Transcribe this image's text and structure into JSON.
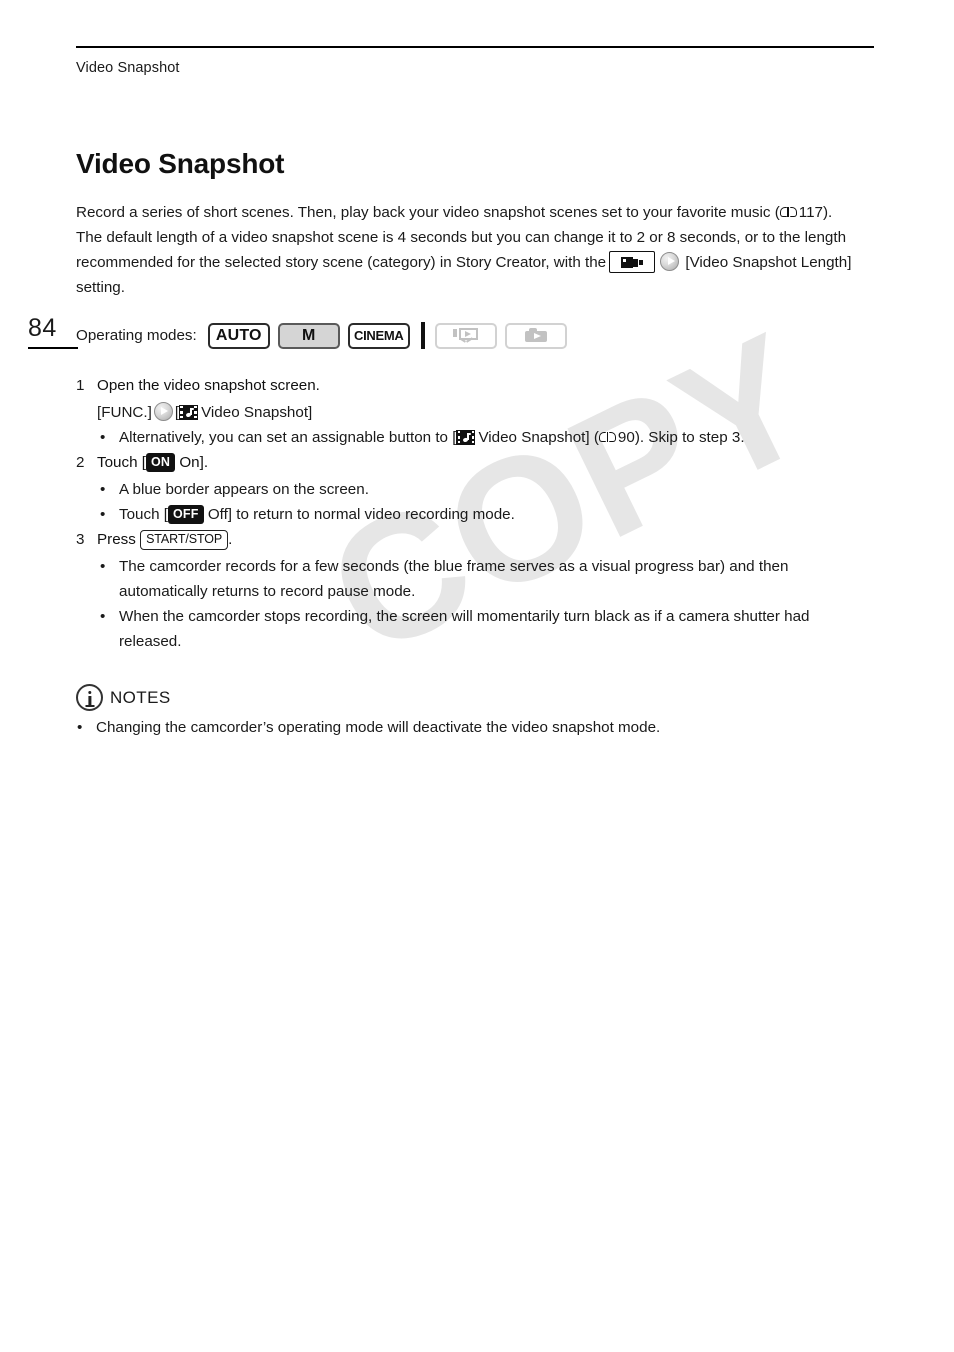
{
  "page": {
    "number": "84",
    "running_head": "Video Snapshot",
    "watermark": "COPY"
  },
  "section": {
    "title": "Video Snapshot",
    "intro_1": "Record a series of short scenes. Then, play back your video snapshot scenes set to your favorite music (",
    "intro_1_ref": "117",
    "intro_1_end": ").",
    "intro_2": "The default length of a video snapshot scene is 4 seconds but you can change it to 2 or 8 seconds, or to the length recommended for the selected story scene (category) in Story Creator, with the",
    "intro_2_end": "[Video Snapshot Length] setting."
  },
  "operating_modes": {
    "label": "Operating modes:",
    "badges": [
      {
        "label": "AUTO",
        "state": "enabled",
        "style": "outline"
      },
      {
        "label": "M",
        "state": "enabled",
        "style": "filled"
      },
      {
        "label": "CINEMA",
        "state": "enabled",
        "style": "outline"
      },
      {
        "label": "",
        "state": "disabled",
        "icon": "movie-playback-icon"
      },
      {
        "label": "",
        "state": "disabled",
        "icon": "photo-playback-icon"
      }
    ]
  },
  "steps": [
    {
      "number": "1",
      "title": "Open the video snapshot screen.",
      "menu_path_start": "[FUNC.]",
      "menu_path_end": "Video Snapshot]",
      "menu_path_bracket": "[",
      "bullets": [
        {
          "text_1": "Alternatively, you can set an assignable button to [",
          "text_2": "Video Snapshot] (",
          "ref": "90",
          "text_3": "). Skip to step 3."
        }
      ]
    },
    {
      "number": "2",
      "title_prefix": "Touch [",
      "badge": "ON",
      "title_suffix": "On].",
      "bullets": [
        {
          "text_1": "A blue border appears on the screen."
        },
        {
          "text_1": "Touch [",
          "badge": "OFF",
          "text_2": "Off] to return to normal video recording mode."
        }
      ]
    },
    {
      "number": "3",
      "title_prefix": "Press",
      "key": "START/STOP",
      "title_suffix": ".",
      "bullets": [
        {
          "text_1": "The camcorder records for a few seconds (the blue frame serves as a visual progress bar) and then automatically returns to record pause mode."
        },
        {
          "text_1": "When the camcorder stops recording, the screen will momentarily turn black as if a camera shutter had released."
        }
      ]
    }
  ],
  "notes": {
    "label": "NOTES",
    "items": [
      "Changing the camcorder’s operating mode will deactivate the video snapshot mode."
    ]
  },
  "symbols": {
    "bullet": "•"
  }
}
